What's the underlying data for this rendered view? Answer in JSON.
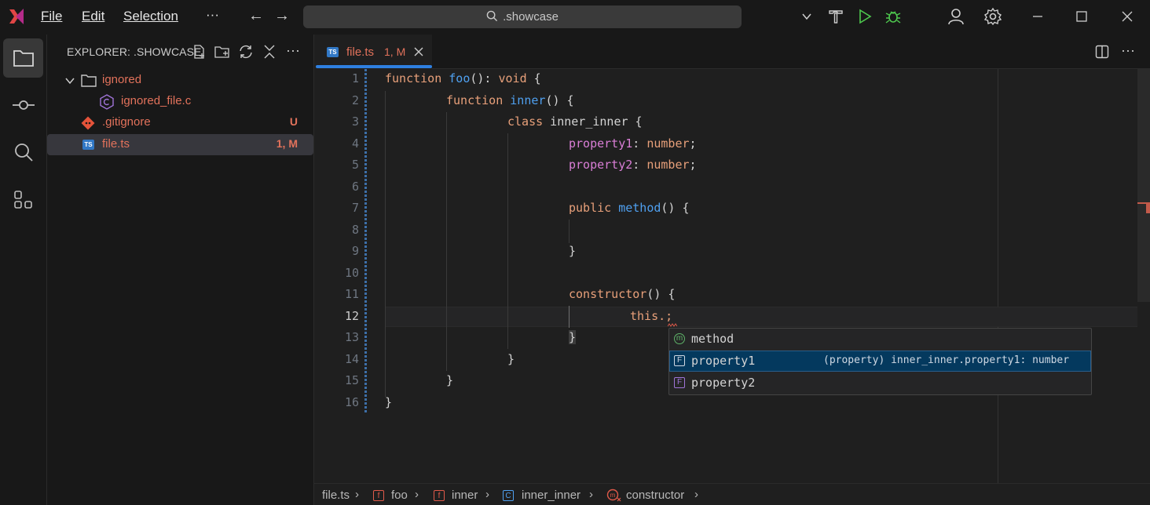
{
  "menu": {
    "file": "File",
    "edit": "Edit",
    "selection": "Selection",
    "more": "···"
  },
  "search": {
    "text": ".showcase"
  },
  "sidebar": {
    "title": "EXPLORER: .SHOWCASE",
    "tree": [
      {
        "label": "ignored",
        "type": "folder",
        "color": "#e2725b"
      },
      {
        "label": "ignored_file.c",
        "type": "file-c",
        "color": "#e2725b"
      },
      {
        "label": ".gitignore",
        "type": "file-git",
        "badge": "U",
        "color": "#e2725b"
      },
      {
        "label": "file.ts",
        "type": "file-ts",
        "badge": "1, M",
        "color": "#e2725b"
      }
    ]
  },
  "tab": {
    "icon": "TS",
    "label": "file.ts",
    "badge": "1, M"
  },
  "editor": {
    "lines": [
      "1",
      "2",
      "3",
      "4",
      "5",
      "6",
      "7",
      "8",
      "9",
      "10",
      "11",
      "12",
      "13",
      "14",
      "15",
      "16"
    ],
    "code": {
      "l1_kw": "function",
      "l1_fn": "foo",
      "l1_rest": "(): ",
      "l1_type": "void",
      "l1_end": " {",
      "l2_kw": "function",
      "l2_fn": "inner",
      "l2_end": "() {",
      "l3_kw": "class",
      "l3_rest": " inner_inner {",
      "l4_prop": "property1",
      "l4_colon": ": ",
      "l4_type": "number",
      "l4_end": ";",
      "l5_prop": "property2",
      "l5_colon": ": ",
      "l5_type": "number",
      "l5_end": ";",
      "l7_kw": "public",
      "l7_fn": "method",
      "l7_end": "() {",
      "l9": "}",
      "l11_kw": "constructor",
      "l11_end": "() {",
      "l12": "this.;",
      "l13": "}",
      "l14": "}",
      "l15": "}",
      "l16": "}"
    }
  },
  "suggest": [
    {
      "icon": "m",
      "label": "method",
      "detail": ""
    },
    {
      "icon": "F",
      "label": "property1",
      "detail": "(property) inner_inner.property1: number",
      "selected": true
    },
    {
      "icon": "F",
      "label": "property2",
      "detail": ""
    }
  ],
  "breadcrumb": {
    "file": "file.ts",
    "foo": "foo",
    "inner": "inner",
    "inner_inner": "inner_inner",
    "constructor": "constructor",
    "sep": "›"
  },
  "colors": {
    "accent": "#2e7fe0",
    "modified": "#e2725b",
    "selection": "#04395e"
  }
}
